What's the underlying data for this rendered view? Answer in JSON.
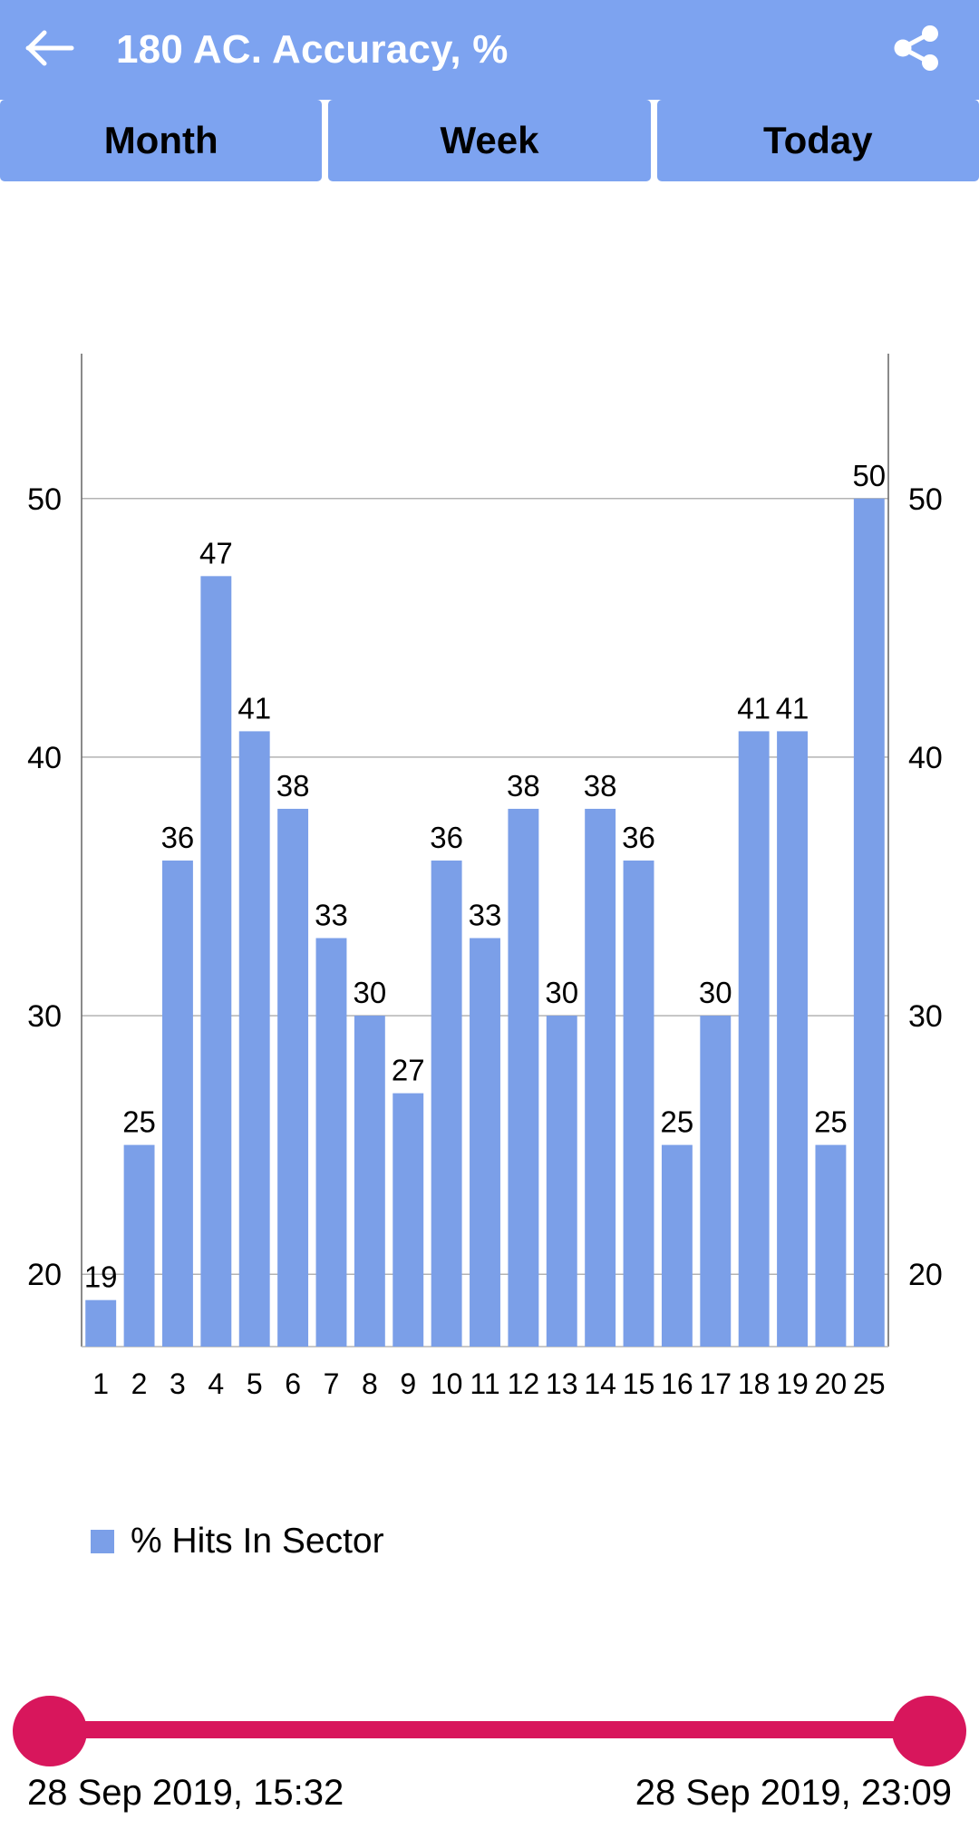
{
  "appbar": {
    "title": "180 AC. Accuracy, %",
    "back_icon": "arrow-left-icon",
    "share_icon": "share-icon",
    "background_color": "#7da3f0",
    "title_color": "#ffffff"
  },
  "tabs": [
    {
      "label": "Month"
    },
    {
      "label": "Week"
    },
    {
      "label": "Today"
    }
  ],
  "legend": {
    "label": "% Hits In Sector",
    "color": "#7b9fe8"
  },
  "slider": {
    "start_label": "28 Sep 2019, 15:32",
    "end_label": "28 Sep 2019, 23:09",
    "color": "#d8165c"
  },
  "chart_data": {
    "type": "bar",
    "title": "",
    "xlabel": "",
    "ylabel": "",
    "categories": [
      "1",
      "2",
      "3",
      "4",
      "5",
      "6",
      "7",
      "8",
      "9",
      "10",
      "11",
      "12",
      "13",
      "14",
      "15",
      "16",
      "17",
      "18",
      "19",
      "20",
      "25"
    ],
    "values": [
      19,
      25,
      36,
      47,
      41,
      38,
      33,
      30,
      27,
      36,
      33,
      38,
      30,
      38,
      36,
      25,
      30,
      41,
      41,
      25,
      50
    ],
    "series": [
      {
        "name": "% Hits In Sector",
        "color": "#7b9fe8",
        "values": [
          19,
          25,
          36,
          47,
          41,
          38,
          33,
          30,
          27,
          36,
          33,
          38,
          30,
          38,
          36,
          25,
          30,
          41,
          41,
          25,
          50
        ]
      }
    ],
    "ylim": [
      17.2,
      53.5
    ],
    "yticks": [
      20,
      30,
      40,
      50
    ],
    "yticks_right": [
      20,
      30,
      40,
      50
    ],
    "grid": true,
    "legend_position": "bottom-left",
    "data_labels": true
  }
}
